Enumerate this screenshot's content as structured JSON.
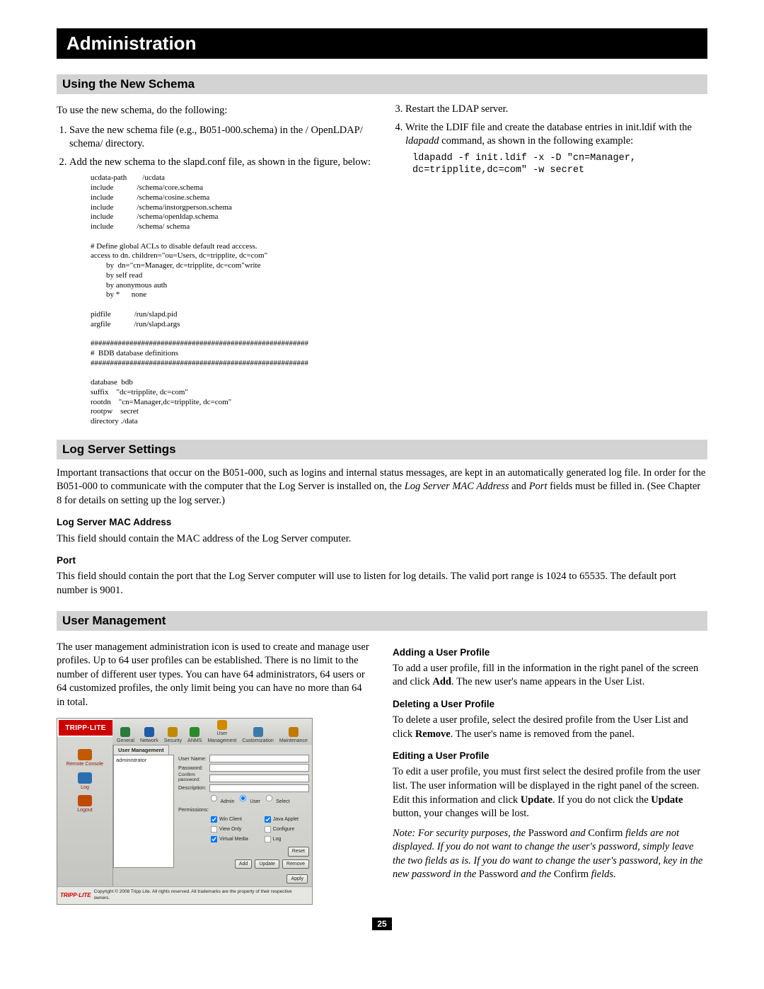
{
  "page_title": "Administration",
  "page_number": "25",
  "sections": {
    "schema": {
      "header": "Using the New Schema",
      "intro": "To use the new schema, do the following:",
      "left_steps": [
        "Save the new schema file (e.g., B051-000.schema) in the / OpenLDAP/ schema/ directory.",
        "Add the new schema to the slapd.conf file, as shown in the figure, below:"
      ],
      "config_block": "ucdata-path        /ucdata\ninclude            /schema/core.schema\ninclude            /schema/cosine.schema\ninclude            /schema/instorgperson.schema\ninclude            /schema/openldap.schema\ninclude            /schema/ schema\n\n# Define global ACLs to disable default read acccess.\naccess to dn. children=\"ou=Users, dc=tripplite, dc=com\"\n        by  dn=\"cn=Manager, dc=tripplite, dc=com\"write\n        by self read\n        by anonymous auth\n        by *      none\n\npidfile            /run/slapd.pid\nargfile            /run/slapd.args\n\n########################################################\n#  BDB database definitions\n########################################################\n\ndatabase  bdb\nsuffix    \"dc=tripplite, dc=com\"\nrootdn    \"cn=Manager,dc=tripplite, dc=com\"\nrootpw    secret\ndirectory ./data",
      "right_step3": "Restart the LDAP server.",
      "right_step4_pre": "Write the LDIF file and create the database entries in init.ldif with the ",
      "right_step4_cmd": "ldapadd",
      "right_step4_post": " command, as shown in the following example:",
      "ldap_cmd": "ldapadd -f init.ldif -x -D \"cn=Manager,\ndc=tripplite,dc=com\" -w secret"
    },
    "log": {
      "header": "Log Server Settings",
      "intro_a": "Important transactions that occur on the B051-000, such as logins and internal status messages, are kept in an automatically generated log file. In order for the B051-000 to communicate with the computer that the Log Server is installed on, the ",
      "intro_b": "Log Server MAC Address",
      "intro_c": " and ",
      "intro_d": "Port",
      "intro_e": " fields must be filled in. (See Chapter 8 for details on setting up the log server.)",
      "mac_heading": "Log Server MAC Address",
      "mac_text": "This field should contain the MAC address of the Log Server computer.",
      "port_heading": "Port",
      "port_text": "This field should contain the port that the Log Server computer will use to listen for log details. The valid port range is 1024 to 65535. The default port number is 9001."
    },
    "user": {
      "header": "User Management",
      "left_text": "The user management administration icon is used to create and manage user profiles. Up to 64 user profiles can be established. There is no limit to the number of different user types. You can have 64 administrators, 64 users or 64 customized profiles, the only limit being you can have no more than 64 in total.",
      "add_h": "Adding a User Profile",
      "add_t1": "To add a user profile, fill in the information in the right panel of the screen and click ",
      "add_bold": "Add",
      "add_t2": ". The new user's name appears in the User List.",
      "del_h": "Deleting a User Profile",
      "del_t1": "To delete a user profile, select the desired profile from the User List and click ",
      "del_bold": "Remove",
      "del_t2": ". The user's name is removed from the panel.",
      "edit_h": "Editing a User Profile",
      "edit_t1": "To edit a user profile, you must first select the desired profile from the user list. The user information will be displayed in the right panel of the screen. Edit this information and click ",
      "edit_bold1": "Update",
      "edit_t2": ". If you do not click the ",
      "edit_bold2": "Update",
      "edit_t3": " button, your changes will be lost.",
      "note_1": "Note: For security purposes, the ",
      "note_pw": "Password",
      "note_2": " and ",
      "note_cf": "Confirm",
      "note_3": " fields are not displayed. If you do not want to change the user's password, simply leave the two fields as is. If you do want to change the user's password, key in the new password in the ",
      "note_4": " and the ",
      "note_5": " fields."
    }
  },
  "ui": {
    "logo": "TRIPP·LITE",
    "toolbar": [
      {
        "label": "General",
        "color": "#2a7a3a"
      },
      {
        "label": "Network",
        "color": "#1e5aa8"
      },
      {
        "label": "Security",
        "color": "#c08a00"
      },
      {
        "label": "ANMS",
        "color": "#2a8a2a"
      },
      {
        "label": "User\nManagement",
        "color": "#d08a00"
      },
      {
        "label": "Customization",
        "color": "#3a7aa8"
      },
      {
        "label": "Maintenance",
        "color": "#c07a00"
      }
    ],
    "sidebar": [
      {
        "label": "Remote Console",
        "color": "#c05a00"
      },
      {
        "label": "Log",
        "color": "#2a70b0"
      },
      {
        "label": "Logout",
        "color": "#c04a00"
      }
    ],
    "tab": "User Management",
    "list_item": "administrator",
    "fields": {
      "username": "User Name:",
      "password": "Password:",
      "confirm": "Confirm\npassword:",
      "description": "Description:",
      "permissions": "Permissions:"
    },
    "radios": [
      "Admin",
      "User",
      "Select"
    ],
    "perms": [
      "Win Client",
      "Java Applet",
      "View Only",
      "Configure",
      "Virtual Media",
      "Log"
    ],
    "buttons": {
      "reset": "Reset",
      "add": "Add",
      "update": "Update",
      "remove": "Remove",
      "apply": "Apply"
    },
    "footer": "Copyright © 2008 Tripp Lite. All rights reserved. All trademarks are the property of their respective owners."
  }
}
